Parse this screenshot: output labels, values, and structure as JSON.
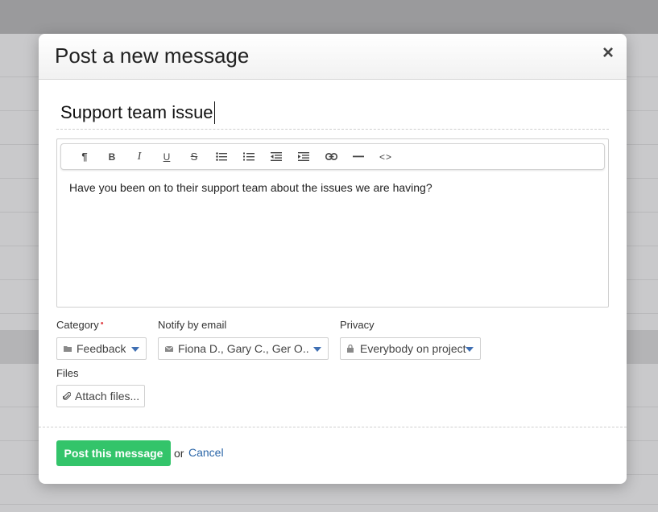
{
  "modal": {
    "title": "Post a new message",
    "close_symbol": "×"
  },
  "subject": {
    "value": "Support team issue"
  },
  "editor": {
    "toolbar": [
      {
        "name": "paragraph-icon",
        "glyph": "¶"
      },
      {
        "name": "bold-icon",
        "glyph": "B"
      },
      {
        "name": "italic-icon",
        "glyph": "I"
      },
      {
        "name": "underline-icon",
        "glyph": "U"
      },
      {
        "name": "strikethrough-icon",
        "glyph": "S"
      },
      {
        "name": "bullet-list-icon",
        "glyph": ""
      },
      {
        "name": "numbered-list-icon",
        "glyph": ""
      },
      {
        "name": "outdent-icon",
        "glyph": ""
      },
      {
        "name": "indent-icon",
        "glyph": ""
      },
      {
        "name": "link-icon",
        "glyph": ""
      },
      {
        "name": "horizontal-rule-icon",
        "glyph": ""
      },
      {
        "name": "code-icon",
        "glyph": "<>"
      }
    ],
    "body": "Have you been on to their support team about the issues we are having?"
  },
  "fields": {
    "category": {
      "label": "Category",
      "required_mark": "•",
      "value": "Feedback",
      "icon": "folder-icon"
    },
    "notify": {
      "label": "Notify by email",
      "value": "Fiona D., Gary C., Ger O...",
      "icon": "envelope-icon"
    },
    "privacy": {
      "label": "Privacy",
      "value": "Everybody on project",
      "icon": "lock-icon"
    },
    "files": {
      "label": "Files",
      "attach_label": "Attach files...",
      "icon": "paperclip-icon"
    }
  },
  "footer": {
    "post_label": "Post this message",
    "or_text": "or",
    "cancel_label": "Cancel"
  },
  "colors": {
    "accent_green": "#33c46a",
    "link_blue": "#2b66a8",
    "caret_blue": "#3f6fb3",
    "required_red": "#e0474c"
  }
}
